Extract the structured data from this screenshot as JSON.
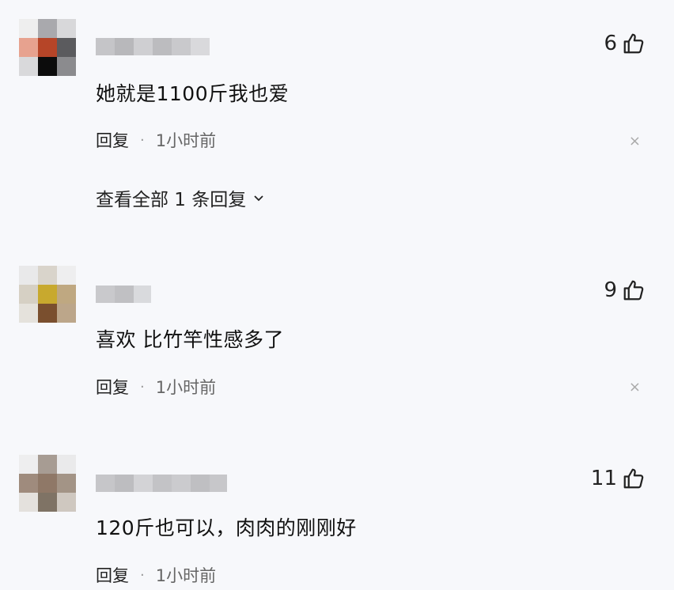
{
  "comments": [
    {
      "likes": "6",
      "text": "她就是1100斤我也爱",
      "reply_label": "回复",
      "dot": "·",
      "time": "1小时前",
      "close": "×",
      "view_all": "查看全部 1 条回复"
    },
    {
      "likes": "9",
      "text": "喜欢 比竹竿性感多了",
      "reply_label": "回复",
      "dot": "·",
      "time": "1小时前",
      "close": "×"
    },
    {
      "likes": "11",
      "text": "120斤也可以，肉肉的刚刚好",
      "reply_label": "回复",
      "dot": "·",
      "time": "1小时前"
    }
  ],
  "colors": {
    "background": "#f7f8fb",
    "text": "#111111",
    "meta": "#666666"
  },
  "icons": {
    "like": "thumbs-up-icon",
    "expand": "chevron-down-icon",
    "dismiss": "close-icon"
  }
}
